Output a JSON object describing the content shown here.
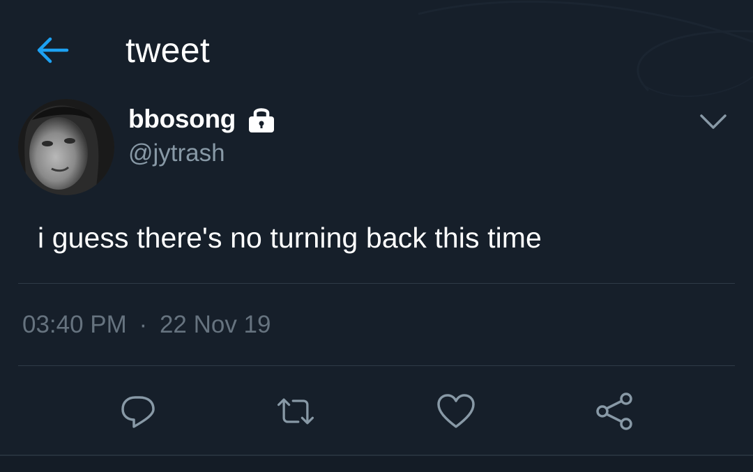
{
  "header": {
    "title": "tweet",
    "back_icon": "arrow-left-icon"
  },
  "tweet": {
    "display_name": "bbosong",
    "protected_icon": "lock-icon",
    "handle": "@jytrash",
    "text": "i guess there's no turning back this time",
    "time": "03:40 PM",
    "separator": "·",
    "date": "22 Nov 19",
    "menu_icon": "chevron-down-icon"
  },
  "actions": [
    {
      "name": "reply",
      "icon": "reply-icon"
    },
    {
      "name": "retweet",
      "icon": "retweet-icon"
    },
    {
      "name": "like",
      "icon": "heart-icon"
    },
    {
      "name": "share",
      "icon": "share-icon"
    }
  ],
  "colors": {
    "background": "#161f2a",
    "accent": "#1da1f2",
    "secondary_text": "#8899a6",
    "muted_text": "#66737f",
    "icon": "#8899a6",
    "divider": "#2f3b48"
  }
}
